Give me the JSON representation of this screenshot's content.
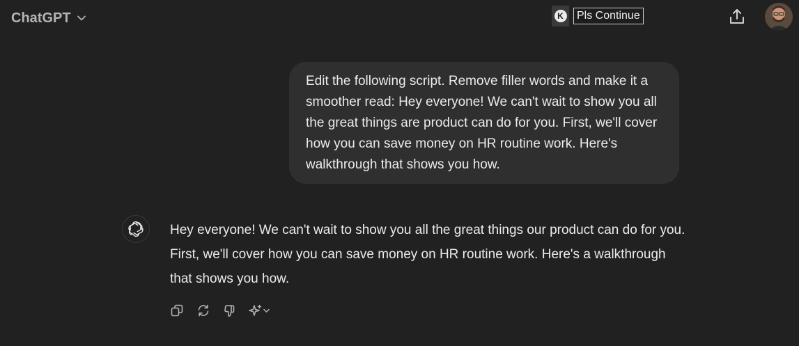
{
  "header": {
    "model_name": "ChatGPT",
    "model_chevron_icon": "chevron-down-icon",
    "extension": {
      "icon_letter": "K",
      "button_label": "Pls Continue"
    },
    "share_icon": "share-upload-icon",
    "avatar_icon": "user-avatar"
  },
  "conversation": {
    "user_message": "Edit the following script. Remove filler words and make it a smoother read: Hey everyone! We can't wait to show you all the great things are product can do for you. First, we'll cover how you can save money on HR routine work. Here's walkthrough that shows you how.",
    "assistant_message": "Hey everyone! We can't wait to show you all the great things our product can do for you. First, we'll cover how you can save money on HR routine work. Here's a walkthrough that shows you how.",
    "assistant_icon": "openai-logo-icon",
    "actions": [
      "copy-icon",
      "regenerate-icon",
      "thumbs-down-icon",
      "sparkle-model-icon"
    ]
  },
  "colors": {
    "background": "#212121",
    "bubble": "#2f2f2f",
    "text": "#ececec",
    "muted": "#b4b4b4"
  }
}
